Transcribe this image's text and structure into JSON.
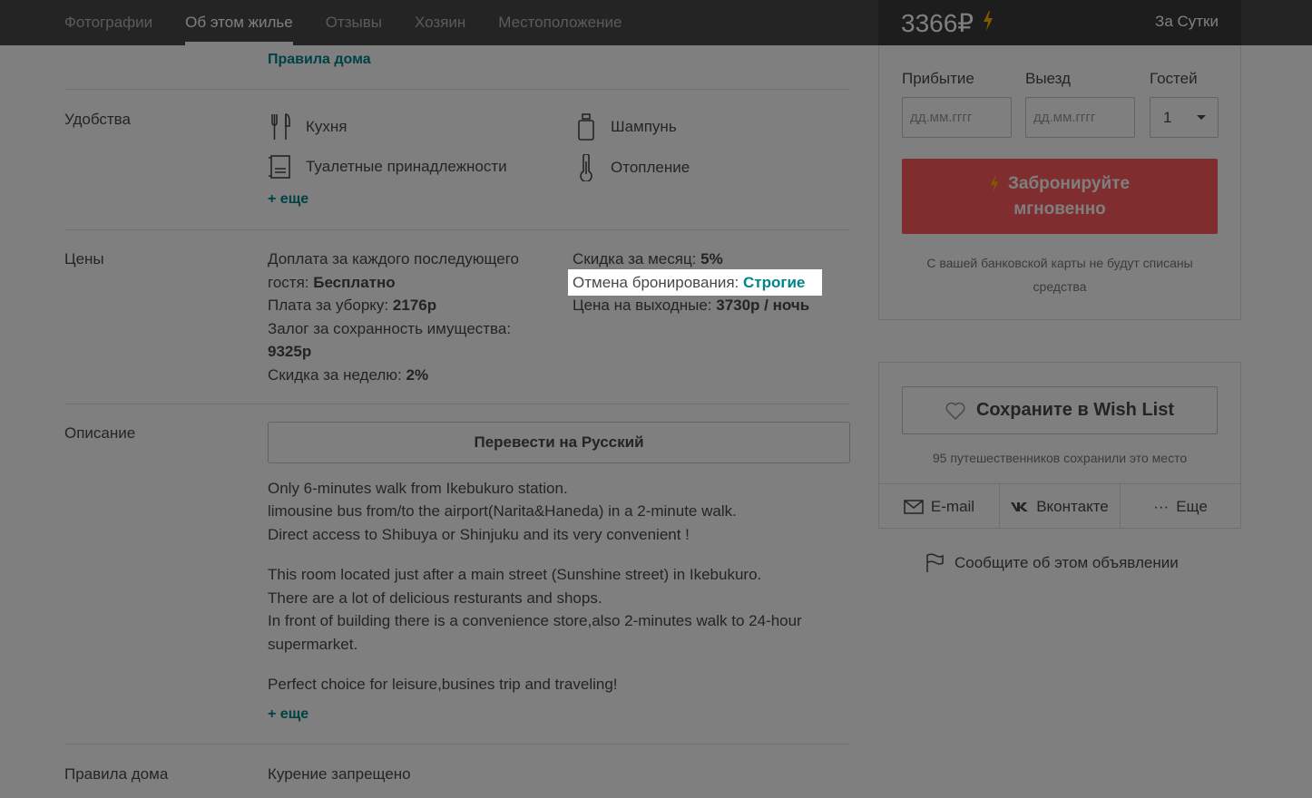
{
  "nav": {
    "tabs": [
      {
        "label": "Фотографии",
        "active": false
      },
      {
        "label": "Об этом жилье",
        "active": true
      },
      {
        "label": "Отзывы",
        "active": false
      },
      {
        "label": "Хозяин",
        "active": false
      },
      {
        "label": "Местоположение",
        "active": false
      }
    ],
    "price": "3366₽",
    "per": "За Сутки"
  },
  "top_link": "Правила дома",
  "amenities": {
    "label": "Удобства",
    "items": [
      {
        "label": "Кухня",
        "icon": "kitchen-icon"
      },
      {
        "label": "Шампунь",
        "icon": "shampoo-icon"
      },
      {
        "label": "Туалетные принадлежности",
        "icon": "toiletries-icon"
      },
      {
        "label": "Отопление",
        "icon": "heating-icon"
      }
    ],
    "more": "+ еще"
  },
  "prices": {
    "label": "Цены",
    "extra_guest_label": "Доплата за каждого последующего",
    "extra_guest_label2": "гостя: ",
    "extra_guest_value": "Бесплатно",
    "cleaning_label": "Плата за уборку: ",
    "cleaning_value": "2176р",
    "deposit_label": "Залог за сохранность имущества:",
    "deposit_value": "9325р",
    "weekly_label": "Скидка за неделю: ",
    "weekly_value": "2%",
    "monthly_label": "Скидка за месяц: ",
    "monthly_value": "5%",
    "cancel_label": "Отмена бронирования: ",
    "cancel_value": "Строгие",
    "weekend_label": "Цена на выходные: ",
    "weekend_value": "3730р / ночь"
  },
  "description": {
    "label": "Описание",
    "translate_button": "Перевести на Русский",
    "lines": [
      "Only 6-minutes walk from Ikebukuro station.",
      "limousine bus from/to the airport(Narita&Haneda) in a 2-minute walk.",
      "Direct access to Shibuya or Shinjuku and its very convenient !",
      "This room located just after a main street (Sunshine street) in Ikebukuro.",
      "There are a lot of delicious resturants and shops.",
      "In front of building there is a convenience store,also 2-minutes walk to 24-hour",
      "supermarket.",
      "Perfect choice for leisure,busines trip and traveling!"
    ],
    "more": "+ еще"
  },
  "house_rules": {
    "label": "Правила дома",
    "first": "Курение запрещено"
  },
  "booking": {
    "checkin_label": "Прибытие",
    "checkout_label": "Выезд",
    "guests_label": "Гостей",
    "checkin_placeholder": "дд.мм.гггг",
    "checkout_placeholder": "дд.мм.гггг",
    "guests_value": "1",
    "book_line1": "Забронируйте",
    "book_line2": "мгновенно",
    "note_line1": "С вашей банковской карты не будут списаны",
    "note_line2": "средства"
  },
  "wishlist": {
    "button": "Сохраните в Wish List",
    "count_text": "95 путешественников сохранили это место",
    "share": [
      {
        "label": "E-mail",
        "icon": "envelope-icon"
      },
      {
        "label": "Вконтакте",
        "icon": "vk-icon"
      },
      {
        "label": "Еще",
        "icon": "ellipsis-icon"
      }
    ]
  },
  "report": "Сообщите об этом объявлении",
  "colors": {
    "accent": "#008489",
    "book": "#ff5a5f",
    "nav": "#484848",
    "bolt": "#ffb400"
  }
}
